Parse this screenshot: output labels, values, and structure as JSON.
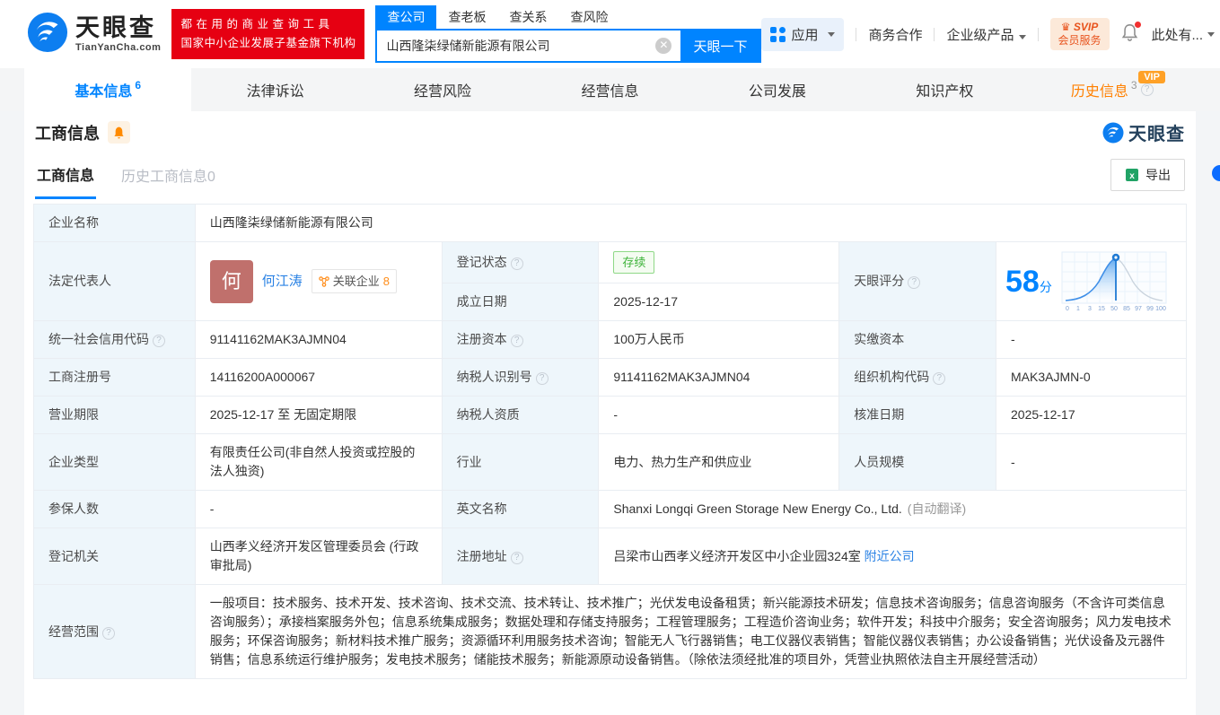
{
  "colors": {
    "accent": "#0084ff",
    "orange": "#ff8000",
    "green": "#3eb33a",
    "brand_red": "#e60012",
    "link": "#2a82e4"
  },
  "header": {
    "logo": {
      "brand": "天眼查",
      "domain": "TianYanCha.com"
    },
    "slogan_line1": "都在用的商业查询工具",
    "slogan_line2": "国家中小企业发展子基金旗下机构",
    "search_tabs": [
      "查公司",
      "查老板",
      "查关系",
      "查风险"
    ],
    "search": {
      "value": "山西隆柒绿储新能源有限公司",
      "button": "天眼一下"
    },
    "nav": {
      "apps": "应用",
      "business": "商务合作",
      "enterprise": "企业级产品",
      "svip_line1": "SVIP",
      "svip_line2": "会员服务",
      "more": "此处有..."
    }
  },
  "tabs": [
    {
      "label": "基本信息",
      "badge": "6"
    },
    {
      "label": "法律诉讼",
      "badge": ""
    },
    {
      "label": "经营风险",
      "badge": ""
    },
    {
      "label": "经营信息",
      "badge": ""
    },
    {
      "label": "公司发展",
      "badge": ""
    },
    {
      "label": "知识产权",
      "badge": ""
    },
    {
      "label": "历史信息",
      "badge": "3",
      "vip": "VIP"
    }
  ],
  "section": {
    "title": "工商信息",
    "watermark": "天眼查",
    "subtabs": [
      "工商信息",
      "历史工商信息0"
    ],
    "export_label": "导出"
  },
  "fields": {
    "company_name": {
      "label": "企业名称",
      "value": "山西隆柒绿储新能源有限公司"
    },
    "legal_rep": {
      "label": "法定代表人",
      "avatar": "何",
      "name": "何江涛",
      "related_label": "关联企业",
      "related_count": "8"
    },
    "reg_status": {
      "label": "登记状态",
      "value": "存续"
    },
    "est_date": {
      "label": "成立日期",
      "value": "2025-12-17"
    },
    "score": {
      "label": "天眼评分",
      "value": "58",
      "unit": "分",
      "axis": [
        "0",
        "1",
        "3",
        "15",
        "50",
        "85",
        "97",
        "99",
        "100"
      ]
    },
    "credit_code": {
      "label": "统一社会信用代码",
      "value": "91141162MAK3AJMN04"
    },
    "reg_capital": {
      "label": "注册资本",
      "value": "100万人民币"
    },
    "paid_capital": {
      "label": "实缴资本",
      "value": "-"
    },
    "reg_number": {
      "label": "工商注册号",
      "value": "14116200A000067"
    },
    "tax_id": {
      "label": "纳税人识别号",
      "value": "91141162MAK3AJMN04"
    },
    "org_code": {
      "label": "组织机构代码",
      "value": "MAK3AJMN-0"
    },
    "biz_term": {
      "label": "营业期限",
      "value": "2025-12-17 至 无固定期限"
    },
    "tax_qualification": {
      "label": "纳税人资质",
      "value": "-"
    },
    "approval_date": {
      "label": "核准日期",
      "value": "2025-12-17"
    },
    "company_type": {
      "label": "企业类型",
      "value": "有限责任公司(非自然人投资或控股的法人独资)"
    },
    "industry": {
      "label": "行业",
      "value": "电力、热力生产和供应业"
    },
    "staff_size": {
      "label": "人员规模",
      "value": "-"
    },
    "insured_count": {
      "label": "参保人数",
      "value": "-"
    },
    "english_name": {
      "label": "英文名称",
      "value": "Shanxi Longqi Green Storage New Energy Co., Ltd.",
      "note": "(自动翻译)"
    },
    "reg_authority": {
      "label": "登记机关",
      "value": "山西孝义经济开发区管理委员会 (行政审批局)"
    },
    "reg_address": {
      "label": "注册地址",
      "value": "吕梁市山西孝义经济开发区中小企业园324室",
      "link": "附近公司"
    },
    "business_scope": {
      "label": "经营范围",
      "value": "一般项目：技术服务、技术开发、技术咨询、技术交流、技术转让、技术推广；光伏发电设备租赁；新兴能源技术研发；信息技术咨询服务；信息咨询服务（不含许可类信息咨询服务）；承接档案服务外包；信息系统集成服务；数据处理和存储支持服务；工程管理服务；工程造价咨询业务；软件开发；科技中介服务；安全咨询服务；风力发电技术服务；环保咨询服务；新材料技术推广服务；资源循环利用服务技术咨询；智能无人飞行器销售；电工仪器仪表销售；智能仪器仪表销售；办公设备销售；光伏设备及元器件销售；信息系统运行维护服务；发电技术服务；储能技术服务；新能源原动设备销售。（除依法须经批准的项目外，凭营业执照依法自主开展经营活动）"
    }
  }
}
